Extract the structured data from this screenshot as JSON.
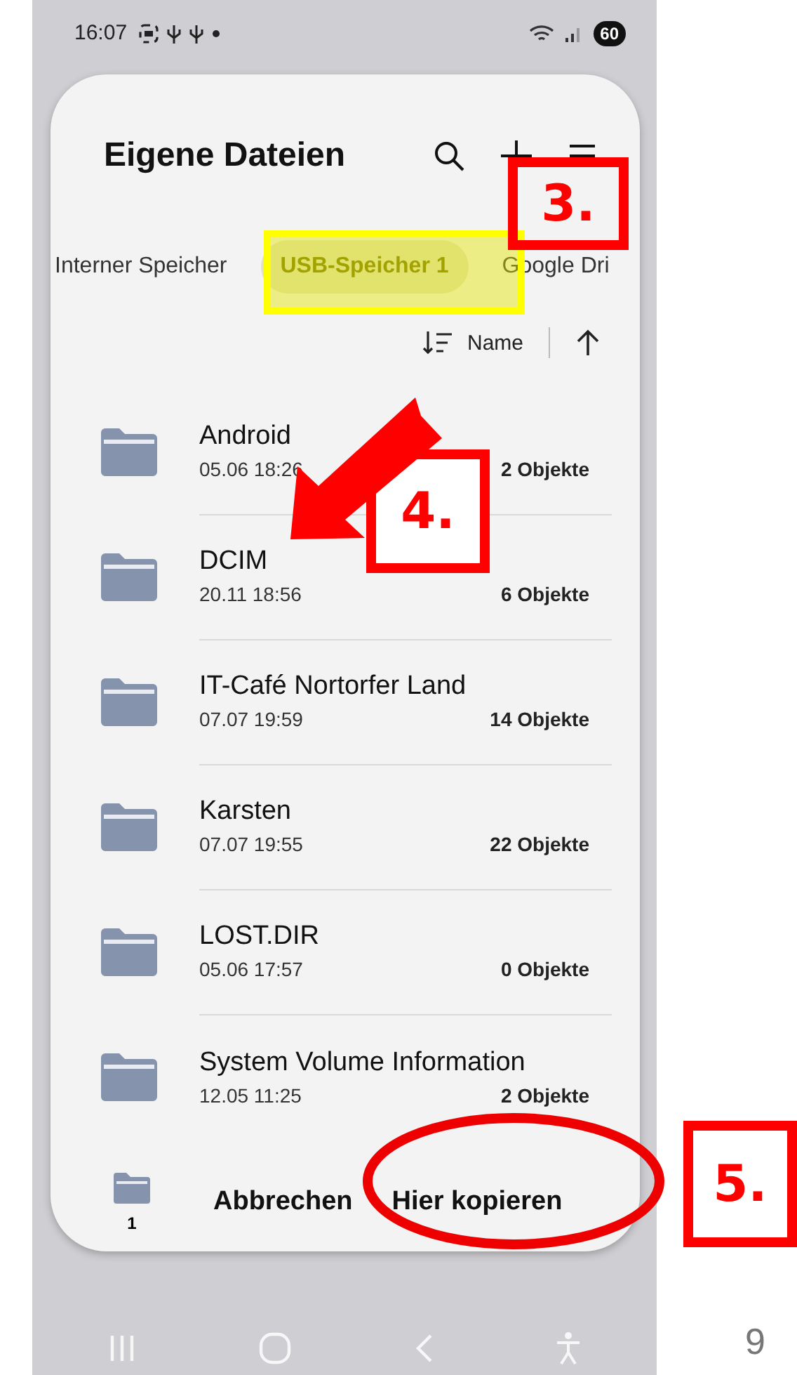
{
  "status_bar": {
    "time": "16:07",
    "battery": "60"
  },
  "header": {
    "title": "Eigene Dateien"
  },
  "tabs": [
    {
      "label": "Interner Speicher",
      "selected": false
    },
    {
      "label": "USB-Speicher 1",
      "selected": true
    },
    {
      "label": "Google Dri",
      "selected": false
    }
  ],
  "sort": {
    "label": "Name"
  },
  "folders": [
    {
      "name": "Android",
      "date": "05.06 18:26",
      "count": "2 Objekte"
    },
    {
      "name": "DCIM",
      "date": "20.11 18:56",
      "count": "6 Objekte"
    },
    {
      "name": "IT-Café Nortorfer Land",
      "date": "07.07 19:59",
      "count": "14 Objekte"
    },
    {
      "name": "Karsten",
      "date": "07.07 19:55",
      "count": "22 Objekte"
    },
    {
      "name": "LOST.DIR",
      "date": "05.06 17:57",
      "count": "0 Objekte"
    },
    {
      "name": "System Volume Information",
      "date": "12.05 11:25",
      "count": "2 Objekte"
    }
  ],
  "bottom_bar": {
    "selection_count": "1",
    "buttons": [
      "Abbrechen",
      "Hier kopieren"
    ]
  },
  "annotations": [
    {
      "kind": "highlight"
    },
    {
      "kind": "step",
      "label": "3."
    },
    {
      "kind": "arrow"
    },
    {
      "kind": "step",
      "label": "4."
    },
    {
      "kind": "ellipse"
    },
    {
      "kind": "step",
      "label": "5."
    }
  ],
  "page_number": "9"
}
